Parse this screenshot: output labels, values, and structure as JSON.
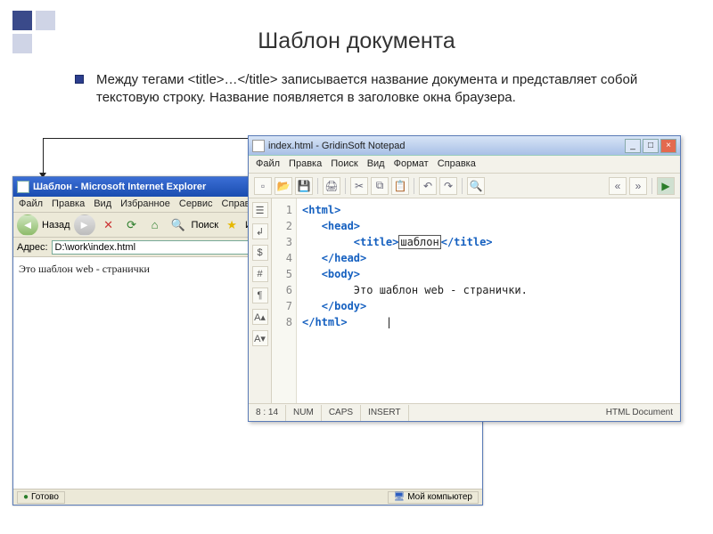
{
  "slide": {
    "title": "Шаблон документа",
    "body": "Между тегами <title>…</title> записывается название документа и представляет собой текстовую строку. Название появляется в заголовке окна браузера."
  },
  "ie": {
    "title": "Шаблон - Microsoft Internet Explorer",
    "menus": [
      "Файл",
      "Правка",
      "Вид",
      "Избранное",
      "Сервис",
      "Справка"
    ],
    "toolbar": {
      "back": "Назад",
      "search": "Поиск",
      "favorites": "Избранное"
    },
    "addr_label": "Адрес:",
    "addr_value": "D:\\work\\index.html",
    "content": "Это шаблон web - странички",
    "status_ready": "Готово",
    "status_zone": "Мой компьютер"
  },
  "np": {
    "title": "index.html - GridinSoft Notepad",
    "menus": [
      "Файл",
      "Правка",
      "Поиск",
      "Вид",
      "Формат",
      "Справка"
    ],
    "code": {
      "lines": [
        "1",
        "2",
        "3",
        "4",
        "5",
        "6",
        "7",
        "8"
      ],
      "l1a": "<html>",
      "l2a": "<head>",
      "l3a": "<title>",
      "l3b": "шаблон",
      "l3c": "</title>",
      "l4a": "</head>",
      "l5a": "<body>",
      "l6a": "Это шаблон web - странички.",
      "l7a": "</body>",
      "l8a": "</html>"
    },
    "status": {
      "pos": "8 : 14",
      "num": "NUM",
      "caps": "CAPS",
      "ins": "INSERT",
      "type": "HTML Document"
    }
  }
}
